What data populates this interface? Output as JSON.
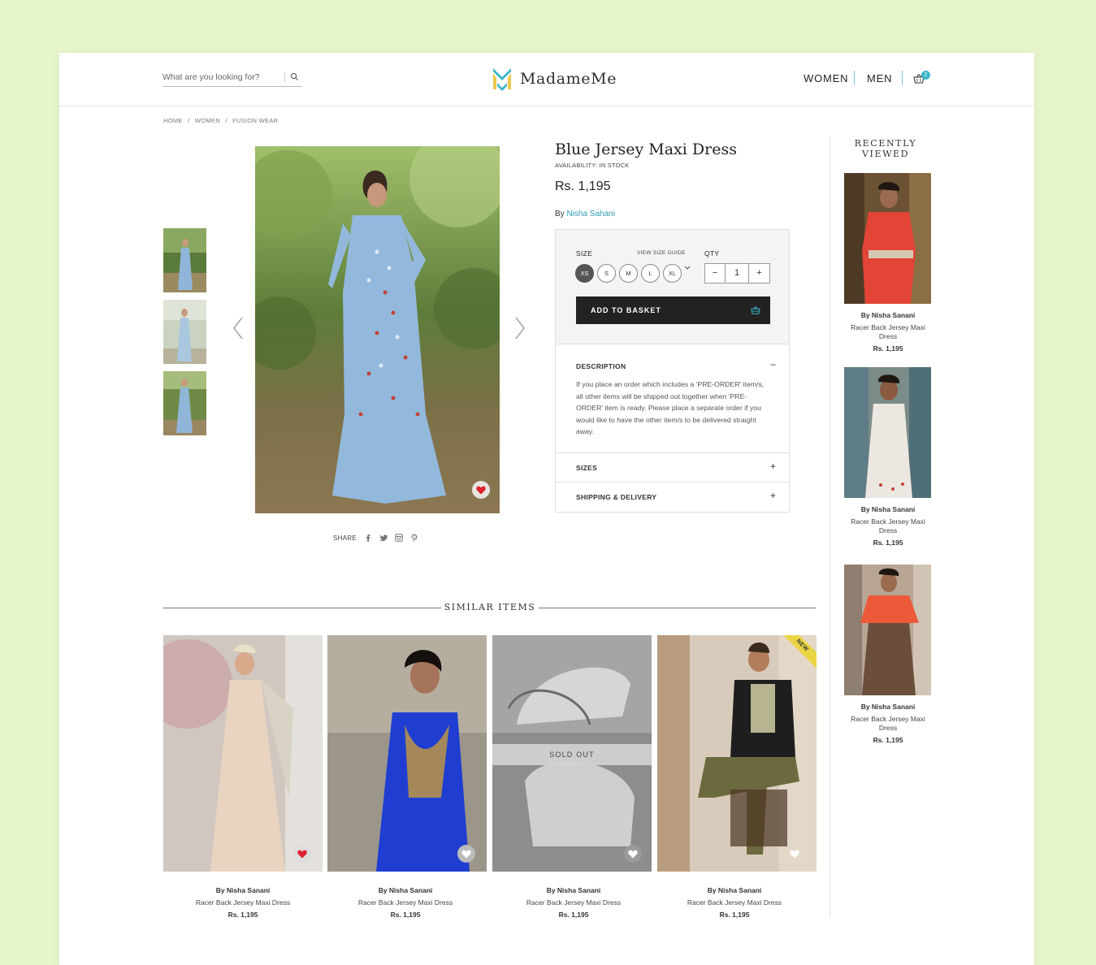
{
  "header": {
    "search_placeholder": "What are you looking for?",
    "brand": "MadameMe",
    "nav": [
      "WOMEN",
      "MEN"
    ],
    "basket_count": "2",
    "accent": "#3bb5c9"
  },
  "breadcrumb": [
    "HOME",
    "/",
    "WOMEN",
    "/",
    "FUSION WEAR"
  ],
  "product": {
    "title": "Blue Jersey Maxi Dress",
    "availability": "AVAILABILITY: IN STOCK",
    "price": "Rs. 1,195",
    "by_prefix": "By",
    "designer": "Nisha Sahani",
    "size_label": "SIZE",
    "size_guide": "VIEW SIZE GUIDE",
    "qty_label": "QTY",
    "sizes": [
      "XS",
      "S",
      "M",
      "L",
      "XL"
    ],
    "selected_size": "XS",
    "qty_minus": "−",
    "qty_value": "1",
    "qty_plus": "+",
    "add_button": "ADD TO BASKET",
    "accordion": {
      "description_title": "DESCRIPTION",
      "description_sign": "−",
      "description_text": "If you place an order which includes a 'PRE-ORDER' item/s, all other items will be shipped out together when 'PRE-ORDER' item is ready. Please place a separate order if you would like to have the other item/s to be delivered straight away.",
      "sizes_title": "SIZES",
      "sizes_sign": "+",
      "shipping_title": "SHIPPING & DELIVERY",
      "shipping_sign": "+"
    },
    "share_label": "SHARE",
    "share_icons": [
      "facebook-icon",
      "twitter-icon",
      "instagram-icon",
      "pinterest-icon"
    ]
  },
  "recently_viewed": {
    "title_line1": "RECENTLY",
    "title_line2": "VIEWED",
    "items": [
      {
        "by": "By Nisha Sanani",
        "name": "Racer Back Jersey Maxi Dress",
        "price": "Rs. 1,195"
      },
      {
        "by": "By Nisha Sanani",
        "name": "Racer Back Jersey Maxi Dress",
        "price": "Rs. 1,195"
      },
      {
        "by": "By Nisha Sanani",
        "name": "Racer Back Jersey Maxi Dress",
        "price": "Rs. 1,195"
      }
    ]
  },
  "similar": {
    "title": "SIMILAR ITEMS",
    "sold_out_label": "SOLD OUT",
    "new_label": "NEW",
    "items": [
      {
        "by": "By Nisha Sanani",
        "name": "Racer Back Jersey Maxi Dress",
        "price": "Rs. 1,195"
      },
      {
        "by": "By Nisha Sanani",
        "name": "Racer Back Jersey Maxi Dress",
        "price": "Rs. 1,195"
      },
      {
        "by": "By Nisha Sanani",
        "name": "Racer Back Jersey Maxi Dress",
        "price": "Rs. 1,195"
      },
      {
        "by": "By Nisha Sanani",
        "name": "Racer Back Jersey Maxi Dress",
        "price": "Rs. 1,195"
      }
    ]
  }
}
